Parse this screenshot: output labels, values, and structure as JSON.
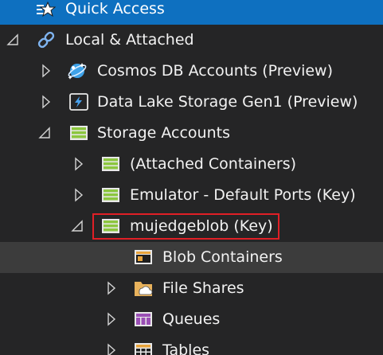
{
  "tree": {
    "items": [
      {
        "label": "Quick Access",
        "icon": "quick-access-icon",
        "state": "none"
      },
      {
        "label": "Local & Attached",
        "icon": "link-icon",
        "state": "expanded"
      },
      {
        "label": "Cosmos DB Accounts (Preview)",
        "icon": "cosmos-db-icon",
        "state": "collapsed"
      },
      {
        "label": "Data Lake Storage Gen1 (Preview)",
        "icon": "data-lake-icon",
        "state": "collapsed"
      },
      {
        "label": "Storage Accounts",
        "icon": "storage-account-icon",
        "state": "expanded"
      },
      {
        "label": "(Attached Containers)",
        "icon": "storage-account-icon",
        "state": "collapsed"
      },
      {
        "label": "Emulator - Default Ports (Key)",
        "icon": "storage-account-icon",
        "state": "collapsed"
      },
      {
        "label": "mujedgeblob (Key)",
        "icon": "storage-account-icon",
        "state": "expanded",
        "highlighted": true
      },
      {
        "label": "Blob Containers",
        "icon": "blob-container-icon",
        "state": "none",
        "hovered": true
      },
      {
        "label": "File Shares",
        "icon": "file-share-icon",
        "state": "collapsed"
      },
      {
        "label": "Queues",
        "icon": "queue-icon",
        "state": "collapsed"
      },
      {
        "label": "Tables",
        "icon": "table-icon",
        "state": "collapsed"
      }
    ]
  },
  "colors": {
    "background": "#252526",
    "selected_row": "#0e70c0",
    "hover_row": "#3c3c3c",
    "highlight_border": "#e01f26",
    "storage_green": "#8cc63f"
  }
}
